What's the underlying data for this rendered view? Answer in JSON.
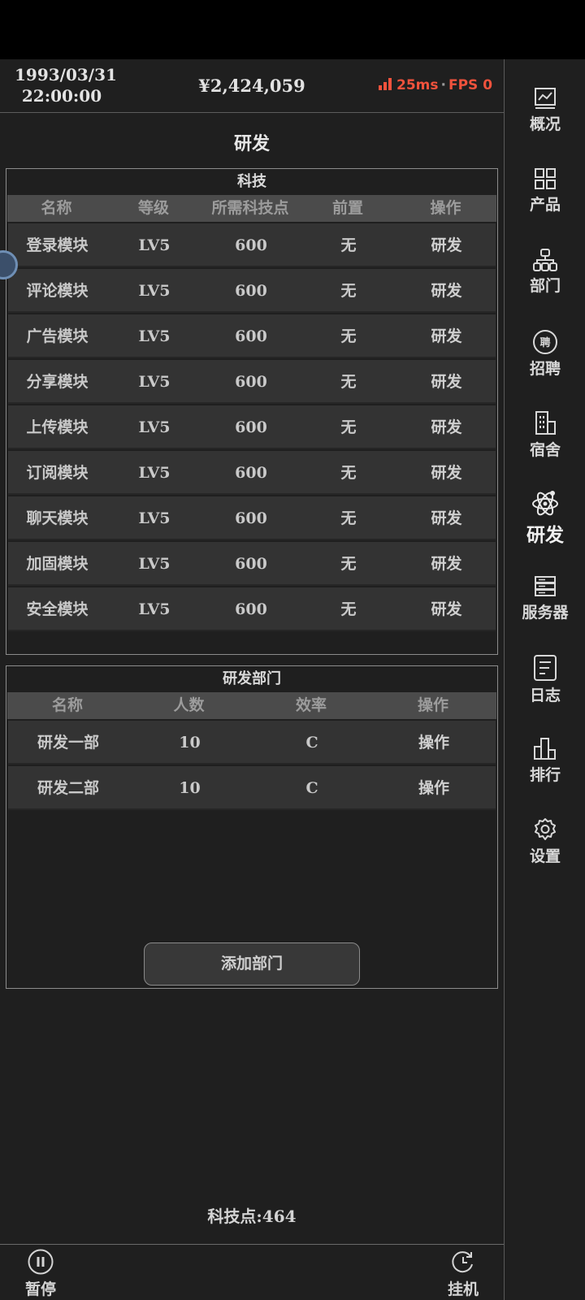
{
  "header": {
    "date": "1993/03/31",
    "time": "22:00:00",
    "money": "¥2,424,059",
    "ping": "25ms",
    "fps_label": "FPS 0"
  },
  "page_title": "研发",
  "tech": {
    "title": "科技",
    "columns": [
      "名称",
      "等级",
      "所需科技点",
      "前置",
      "操作"
    ],
    "rows": [
      {
        "name": "登录模块",
        "level": "LV5",
        "points": "600",
        "prereq": "无",
        "action": "研发"
      },
      {
        "name": "评论模块",
        "level": "LV5",
        "points": "600",
        "prereq": "无",
        "action": "研发"
      },
      {
        "name": "广告模块",
        "level": "LV5",
        "points": "600",
        "prereq": "无",
        "action": "研发"
      },
      {
        "name": "分享模块",
        "level": "LV5",
        "points": "600",
        "prereq": "无",
        "action": "研发"
      },
      {
        "name": "上传模块",
        "level": "LV5",
        "points": "600",
        "prereq": "无",
        "action": "研发"
      },
      {
        "name": "订阅模块",
        "level": "LV5",
        "points": "600",
        "prereq": "无",
        "action": "研发"
      },
      {
        "name": "聊天模块",
        "level": "LV5",
        "points": "600",
        "prereq": "无",
        "action": "研发"
      },
      {
        "name": "加固模块",
        "level": "LV5",
        "points": "600",
        "prereq": "无",
        "action": "研发"
      },
      {
        "name": "安全模块",
        "level": "LV5",
        "points": "600",
        "prereq": "无",
        "action": "研发"
      }
    ]
  },
  "dept": {
    "title": "研发部门",
    "columns": [
      "名称",
      "人数",
      "效率",
      "操作"
    ],
    "rows": [
      {
        "name": "研发一部",
        "count": "10",
        "efficiency": "C",
        "action": "操作"
      },
      {
        "name": "研发二部",
        "count": "10",
        "efficiency": "C",
        "action": "操作"
      }
    ],
    "add_button": "添加部门"
  },
  "tech_points": "科技点:464",
  "bottom": {
    "pause_label": "暂停",
    "idle_label": "挂机"
  },
  "sidebar": {
    "items": [
      {
        "label": "概况",
        "icon": "chart-icon"
      },
      {
        "label": "产品",
        "icon": "grid-icon"
      },
      {
        "label": "部门",
        "icon": "org-icon"
      },
      {
        "label": "招聘",
        "icon": "hire-icon"
      },
      {
        "label": "宿舍",
        "icon": "building-icon"
      },
      {
        "label": "研发",
        "icon": "atom-icon"
      },
      {
        "label": "服务器",
        "icon": "server-icon"
      },
      {
        "label": "日志",
        "icon": "log-icon"
      },
      {
        "label": "排行",
        "icon": "rank-icon"
      },
      {
        "label": "设置",
        "icon": "gear-icon"
      }
    ],
    "active": "研发",
    "hire_glyph": "聘"
  },
  "colors": {
    "background": "#1f1f1f",
    "accent_red": "#f0523c",
    "header_row": "#4b4b4b",
    "row_bg": "#333333"
  }
}
